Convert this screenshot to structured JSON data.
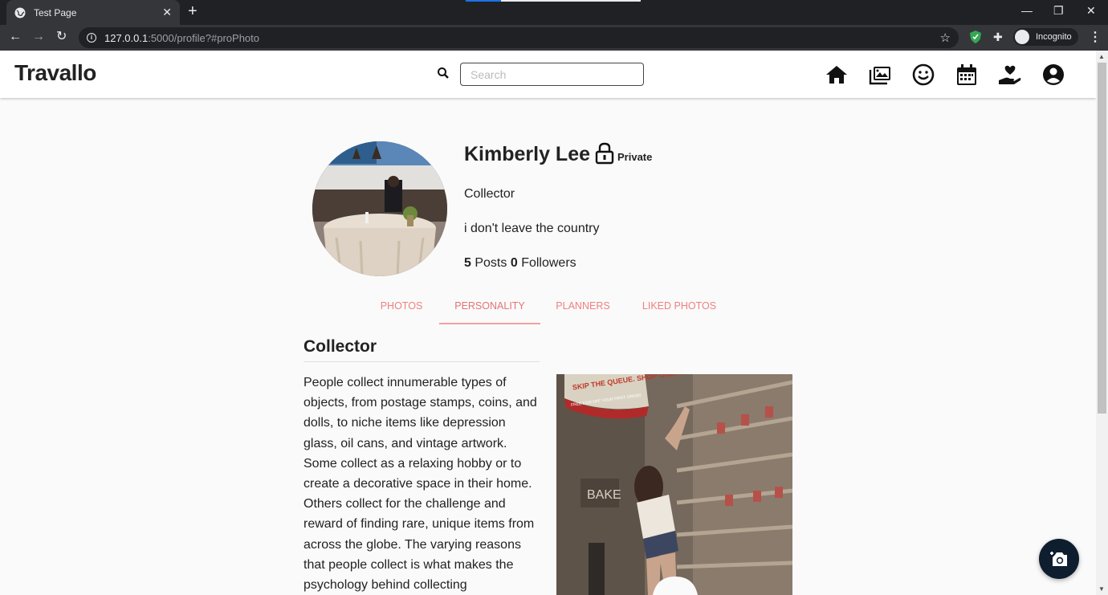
{
  "browser": {
    "tab_title": "Test Page",
    "tab_close": "✕",
    "new_tab": "+",
    "url_host": "127.0.0.1",
    "url_rest": ":5000/profile?#proPhoto",
    "incognito_label": "Incognito",
    "window_controls": {
      "minimize": "—",
      "restore": "❐",
      "close": "✕"
    }
  },
  "site": {
    "logo_text": "Travallo",
    "search_placeholder": "Search",
    "nav_icons": [
      "home-icon",
      "gallery-icon",
      "smile-icon",
      "calendar-icon",
      "donate-icon",
      "account-icon"
    ]
  },
  "profile": {
    "name": "Kimberly Lee",
    "privacy": "Private",
    "personality_type": "Collector",
    "bio": "i don't leave the country",
    "posts_count": "5",
    "posts_label": "Posts",
    "followers_count": "0",
    "followers_label": "Followers"
  },
  "tabs": [
    {
      "label": "PHOTOS",
      "active": false
    },
    {
      "label": "PERSONALITY",
      "active": true
    },
    {
      "label": "PLANNERS",
      "active": false
    },
    {
      "label": "LIKED PHOTOS",
      "active": false
    }
  ],
  "personality": {
    "title": "Collector",
    "description": "People collect innumerable types of objects, from postage stamps, coins, and dolls, to niche items like depression glass, oil cans, and vintage artwork. Some collect as a relaxing hobby or to create a decorative space in their home. Others collect for the challenge and reward of finding rare, unique items from across the globe. The varying reasons that people collect is what makes the psychology behind collecting",
    "photo_sign_text": "SKIP THE QUEUE. SHOP ONLINE",
    "photo_sign_sub": "FREE £100 OFF YOUR FIRST ORDER",
    "photo_bake_text": "BAKE"
  },
  "colors": {
    "tab_accent": "#f08080",
    "fab_bg": "#0f1e2e"
  }
}
